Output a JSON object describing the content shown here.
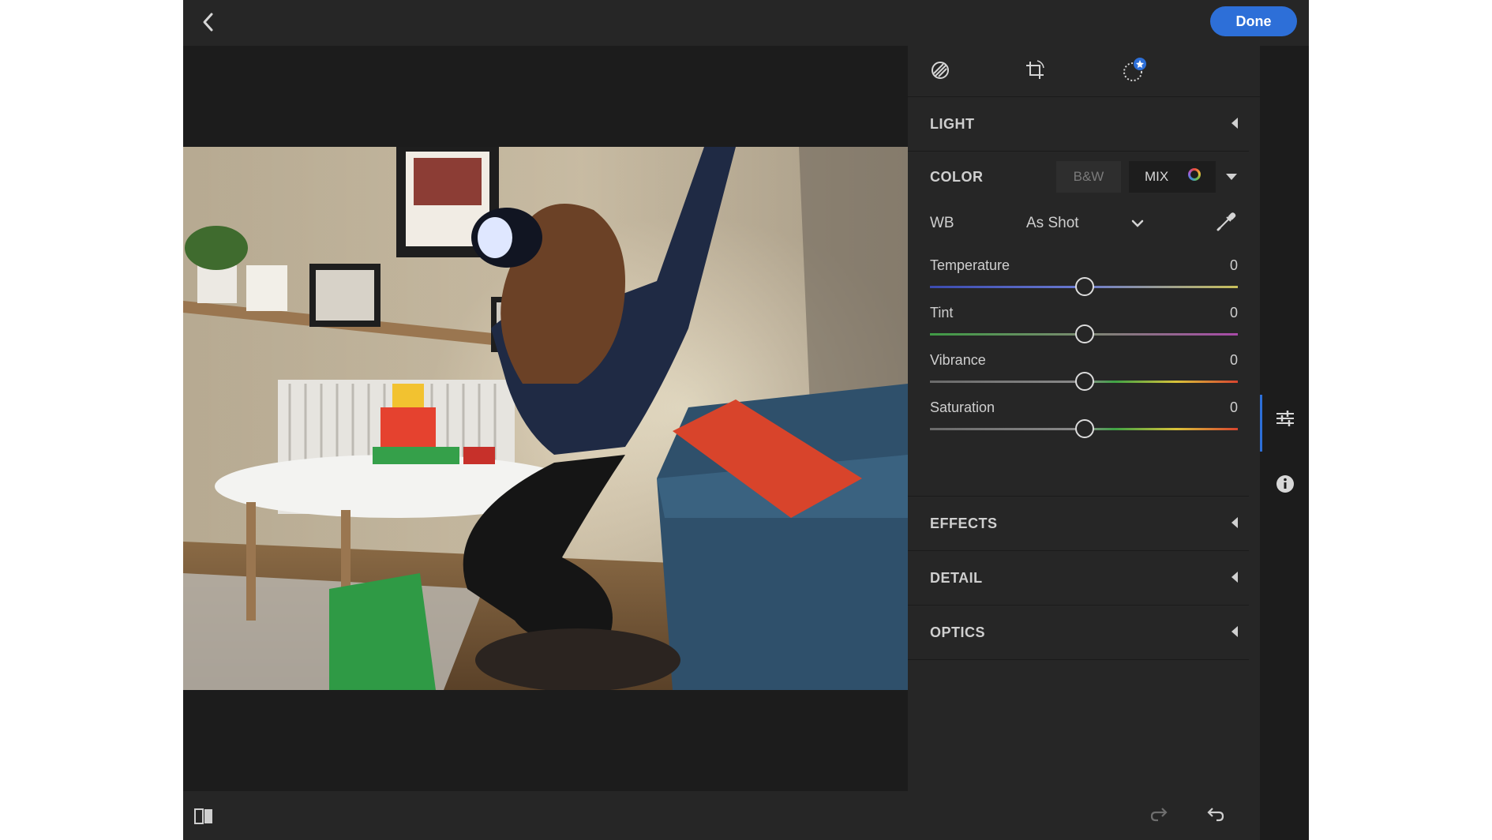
{
  "topbar": {
    "done_label": "Done"
  },
  "icons": {
    "back": "back-chevron-icon",
    "edit_tab": "edit-adjust-icon",
    "crop_tab": "crop-rotate-icon",
    "presets_tab": "presets-star-icon",
    "eyedropper": "eyedropper-icon",
    "adjust": "sliders-icon",
    "info": "info-icon",
    "compare": "before-after-icon",
    "redo": "redo-icon",
    "undo": "undo-icon"
  },
  "panel": {
    "light": {
      "title": "LIGHT"
    },
    "color": {
      "title": "COLOR",
      "bw_label": "B&W",
      "mix_label": "MIX",
      "wb_label": "WB",
      "wb_value": "As Shot",
      "sliders": [
        {
          "label": "Temperature",
          "value": "0",
          "position": 0.5
        },
        {
          "label": "Tint",
          "value": "0",
          "position": 0.5
        },
        {
          "label": "Vibrance",
          "value": "0",
          "position": 0.5
        },
        {
          "label": "Saturation",
          "value": "0",
          "position": 0.5
        }
      ]
    },
    "effects": {
      "title": "EFFECTS"
    },
    "detail": {
      "title": "DETAIL"
    },
    "optics": {
      "title": "OPTICS"
    }
  },
  "colors": {
    "accent": "#2d6fd8",
    "panel_bg": "#262626",
    "app_bg": "#1c1c1c"
  }
}
